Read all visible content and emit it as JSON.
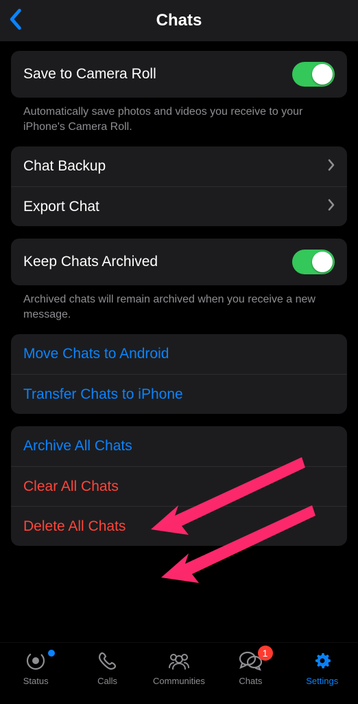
{
  "header": {
    "title": "Chats"
  },
  "sections": {
    "camera": {
      "label": "Save to Camera Roll",
      "toggle": true,
      "footer": "Automatically save photos and videos you receive to your iPhone's Camera Roll."
    },
    "backup": {
      "items": [
        {
          "label": "Chat Backup"
        },
        {
          "label": "Export Chat"
        }
      ]
    },
    "archive": {
      "label": "Keep Chats Archived",
      "toggle": true,
      "footer": "Archived chats will remain archived when you receive a new message."
    },
    "transfer": {
      "items": [
        {
          "label": "Move Chats to Android"
        },
        {
          "label": "Transfer Chats to iPhone"
        }
      ]
    },
    "actions": {
      "items": [
        {
          "label": "Archive All Chats",
          "style": "link"
        },
        {
          "label": "Clear All Chats",
          "style": "danger"
        },
        {
          "label": "Delete All Chats",
          "style": "danger"
        }
      ]
    }
  },
  "tabs": {
    "status": "Status",
    "calls": "Calls",
    "communities": "Communities",
    "chats": "Chats",
    "settings": "Settings",
    "chats_badge": "1"
  },
  "colors": {
    "accent": "#0a84ff",
    "danger": "#ff453a",
    "toggle_on": "#34c759",
    "badge": "#ff3b30",
    "arrow": "#f9245e"
  }
}
